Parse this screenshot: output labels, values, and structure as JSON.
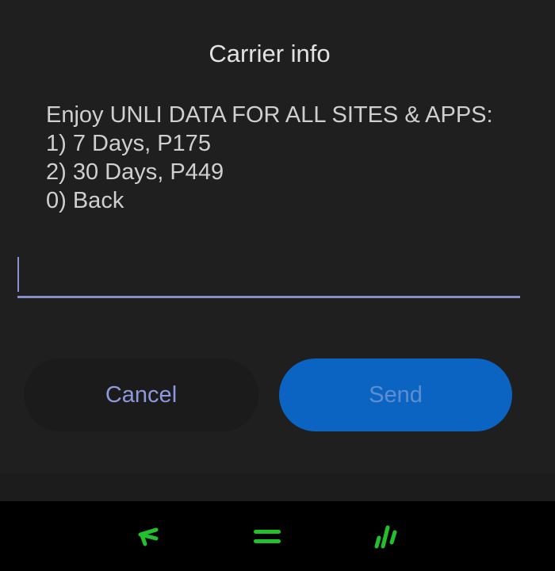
{
  "dialog": {
    "title": "Carrier info",
    "message_lines": [
      "Enjoy UNLI DATA FOR ALL SITES & APPS:",
      "1) 7 Days, P175",
      "2) 30 Days, P449",
      "0) Back"
    ],
    "input": {
      "value": "",
      "placeholder": ""
    },
    "cancel_label": "Cancel",
    "send_label": "Send"
  },
  "navbar": {
    "back_icon": "back-icon",
    "home_icon": "home-icon",
    "recents_icon": "recents-icon",
    "icon_color": "#22c02a"
  },
  "colors": {
    "background": "#1c1c1c",
    "accent": "#0b63c2",
    "cancel_text": "#8e98dd",
    "input_underline": "#8790c8"
  }
}
